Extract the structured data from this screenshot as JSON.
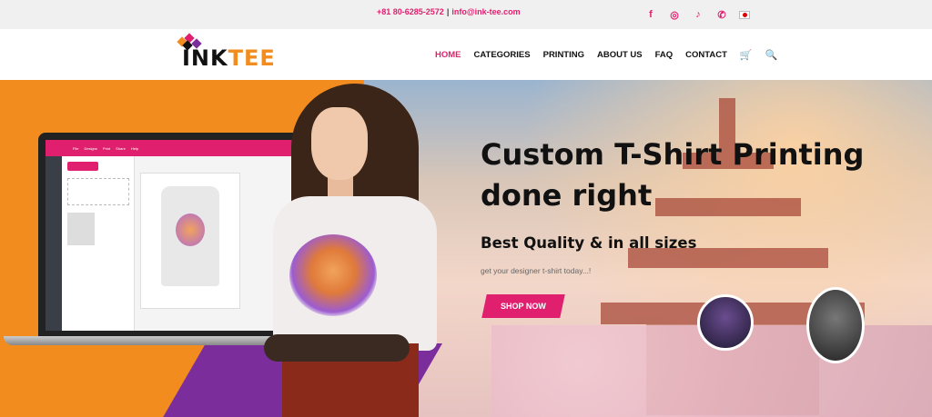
{
  "topbar": {
    "phone": "+81 80-6285-2572",
    "separator": "|",
    "email": "info@ink-tee.com",
    "socials": [
      {
        "name": "facebook-icon",
        "glyph": "f"
      },
      {
        "name": "instagram-icon",
        "glyph": "◎"
      },
      {
        "name": "tiktok-icon",
        "glyph": "♪"
      },
      {
        "name": "whatsapp-icon",
        "glyph": "✆"
      }
    ],
    "flag": "japan-flag-icon"
  },
  "brand": {
    "logo_part1": "INK",
    "logo_part2": "TEE"
  },
  "nav": {
    "items": [
      "HOME",
      "CATEGORIES",
      "PRINTING",
      "ABOUT US",
      "FAQ",
      "CONTACT"
    ],
    "active": "HOME",
    "cart_icon": "cart-icon",
    "search_icon": "search-icon"
  },
  "hero": {
    "headline": "Custom T-Shirt Printing done right",
    "subheadline": "Best Quality & in all sizes",
    "tagline": "get your designer t-shirt today...!",
    "cta": "SHOP NOW"
  },
  "colors": {
    "accent": "#e0206e",
    "orange": "#f28c1e",
    "purple": "#7b2d9c"
  }
}
